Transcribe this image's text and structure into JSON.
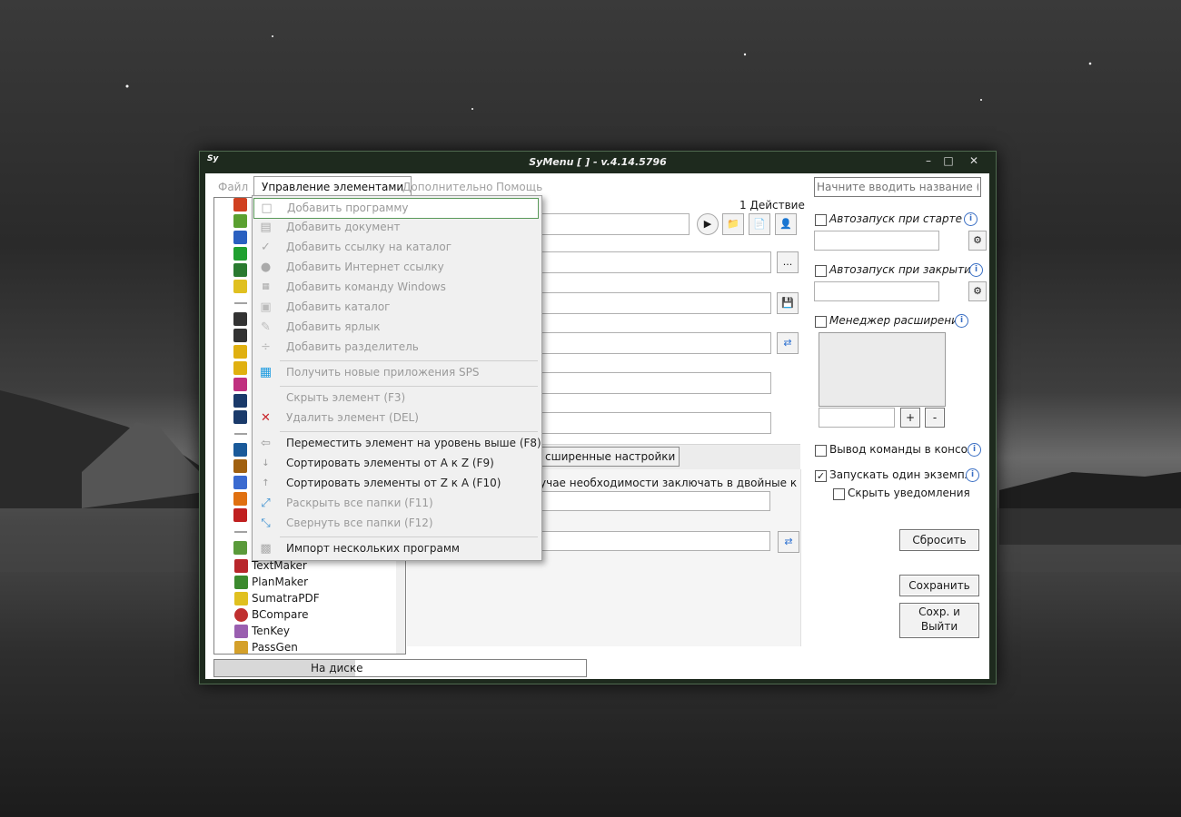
{
  "window": {
    "title": "SyMenu [ ] - v.4.14.5796",
    "logo": "Sy"
  },
  "menubar": {
    "file": "Файл",
    "manage": "Управление элементами",
    "extra": "Дополнительно",
    "help": "Помощь"
  },
  "tree": {
    "items": [
      "TextMaker",
      "PlanMaker",
      "SumatraPDF",
      "BCompare",
      "TenKey",
      "PassGen"
    ]
  },
  "status": {
    "prefix": "На диске"
  },
  "panel": {
    "actions_count": "1 Действие",
    "tab_label": "сширенные настройки",
    "quote_hint": "учае необходимости заключать в двойные к",
    "ellipsis_button": "..."
  },
  "right": {
    "search_placeholder": "Начните вводить название (CTRL",
    "autostart_start": "Автозапуск при старте",
    "autostart_close": "Автозапуск при закрыти",
    "ext_manager": "Менеджер расширений",
    "plus": "+",
    "minus": "-",
    "console_output": "Вывод команды в консол",
    "single_instance": "Запускать один экземпля",
    "hide_notifications": "Скрыть уведомления",
    "reset": "Сбросить",
    "save": "Сохранить",
    "save_exit": "Сохр. и Выйти"
  },
  "context_menu": {
    "add_program": "Добавить программу",
    "add_document": "Добавить документ",
    "add_folder_link": "Добавить ссылку на каталог",
    "add_internet_link": "Добавить Интернет ссылку",
    "add_windows_command": "Добавить команду Windows",
    "add_folder": "Добавить каталог",
    "add_shortcut": "Добавить ярлык",
    "add_separator": "Добавить разделитель",
    "get_sps": "Получить новые приложения SPS",
    "hide_item": "Скрыть элемент (F3)",
    "delete_item": "Удалить элемент (DEL)",
    "move_up": "Переместить элемент на уровень выше (F8)",
    "sort_az": "Сортировать элементы от A к Z (F9)",
    "sort_za": "Сортировать элементы от Z к A (F10)",
    "expand_all": "Раскрыть все папки (F11)",
    "collapse_all": "Свернуть все папки (F12)",
    "import_programs": "Импорт нескольких программ"
  }
}
